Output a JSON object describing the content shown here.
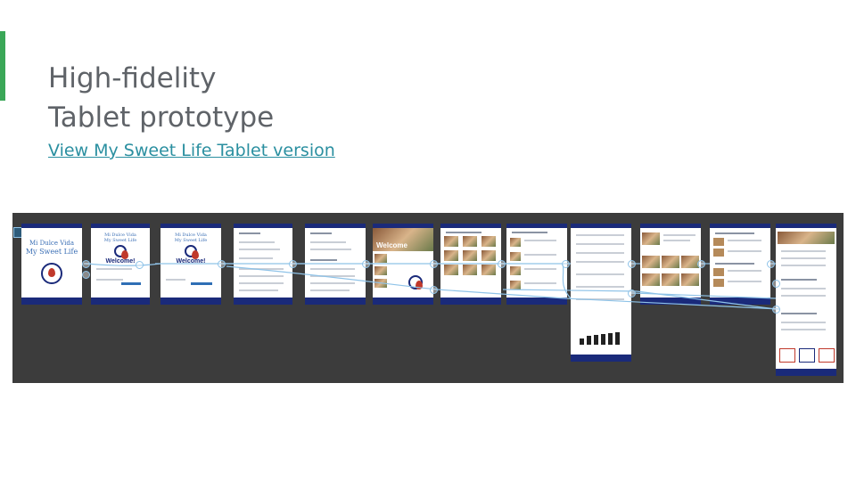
{
  "slide": {
    "title_line1": "High-fidelity",
    "title_line2": "Tablet prototype",
    "link_text": "View My Sweet Life Tablet version"
  },
  "prototype": {
    "logo_line1": "Mi Dulce Vida",
    "logo_line2": "My Sweet Life",
    "welcome_text": "Welcome!",
    "hero_text": "Welcome",
    "screen_count": 12
  },
  "colors": {
    "accent": "#3aa757",
    "link": "#2a8fa0",
    "canvas": "#3c3c3c",
    "brand_navy": "#1a2a7a",
    "connector": "#8fc3e8"
  }
}
